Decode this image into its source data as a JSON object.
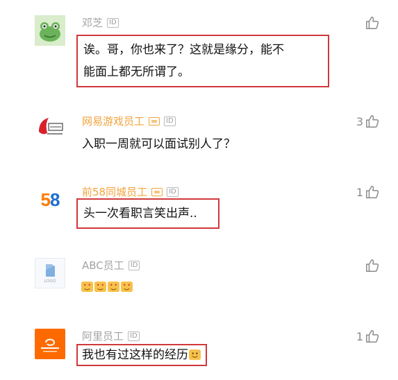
{
  "comments": [
    {
      "username": "邓芝",
      "id_badge": "ID",
      "content": "诶。哥，你也来了？这就是缘分，能不能面上都无所谓了。",
      "content_lines": [
        "诶。哥，你也来了？这就是缘分，能不",
        "能面上都无所谓了。"
      ],
      "likes": "",
      "avatar": "frog-avatar",
      "highlighted": true
    },
    {
      "username": "网易游戏员工",
      "id_badge": "ID",
      "content": "入职一周就可以面试别人了？",
      "likes": "3",
      "avatar": "netease-logo-avatar",
      "highlighted": false
    },
    {
      "username": "前58同城员工",
      "id_badge": "ID",
      "content": "头一次看职言笑出声..",
      "likes": "1",
      "avatar": "58-logo-avatar",
      "avatar_text": "58",
      "highlighted": true
    },
    {
      "username": "ABC员工",
      "id_badge": "ID",
      "content": "",
      "emoji_count": 4,
      "likes": "",
      "avatar": "logo-placeholder-avatar",
      "avatar_text": "LOGO",
      "highlighted": false
    },
    {
      "username": "阿里员工",
      "id_badge": "ID",
      "content": "我也有过这样的经历",
      "likes": "1",
      "avatar": "alibaba-logo-avatar",
      "highlighted": true
    }
  ],
  "colors": {
    "highlight_border": "#d0383a",
    "staff_name": "#f2a23a",
    "username": "#a3a3a3",
    "text": "#111111",
    "alibaba_orange": "#ff6a00",
    "logo_58_orange": "#ff7a00",
    "logo_58_blue": "#1a6fd1"
  }
}
